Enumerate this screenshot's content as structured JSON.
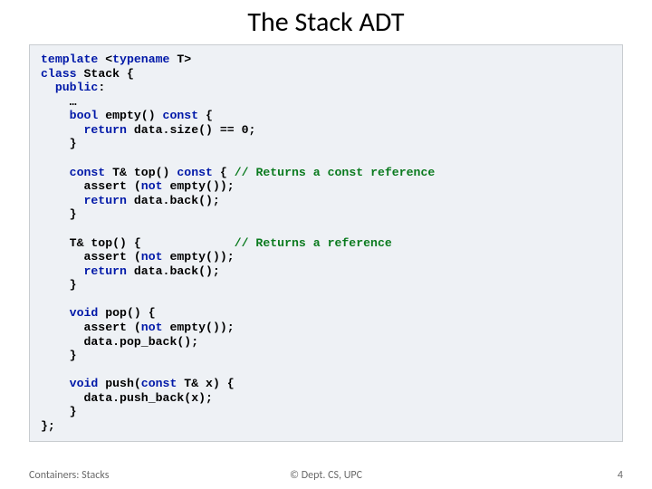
{
  "slide": {
    "title": "The Stack ADT",
    "footer_left": "Containers: Stacks",
    "footer_center": "© Dept. CS, UPC",
    "footer_right": "4"
  },
  "code": {
    "l01a": "template",
    "l01b": " <",
    "l01c": "typename",
    "l01d": " T>",
    "l02a": "class",
    "l02b": " Stack {",
    "l03a": "  public",
    "l03b": ":",
    "l04": "    …",
    "l05a": "    bool",
    "l05b": " empty() ",
    "l05c": "const",
    "l05d": " {",
    "l06a": "      return",
    "l06b": " data.size() == 0;",
    "l07": "    }",
    "blank1": "",
    "l08a": "    const",
    "l08b": " T& top() ",
    "l08c": "const",
    "l08d": " { ",
    "l08e": "// Returns a const reference",
    "l09a": "      assert (",
    "l09b": "not",
    "l09c": " empty());",
    "l10a": "      return",
    "l10b": " data.back();",
    "l11": "    }",
    "blank2": "",
    "l12a": "    T& top() {             ",
    "l12b": "// Returns a reference",
    "l13a": "      assert (",
    "l13b": "not",
    "l13c": " empty());",
    "l14a": "      return",
    "l14b": " data.back();",
    "l15": "    }",
    "blank3": "",
    "l16a": "    void",
    "l16b": " pop() {",
    "l17a": "      assert (",
    "l17b": "not",
    "l17c": " empty());",
    "l18": "      data.pop_back();",
    "l19": "    }",
    "blank4": "",
    "l20a": "    void",
    "l20b": " push(",
    "l20c": "const",
    "l20d": " T& x) {",
    "l21": "      data.push_back(x);",
    "l22": "    }",
    "l23": "};"
  }
}
